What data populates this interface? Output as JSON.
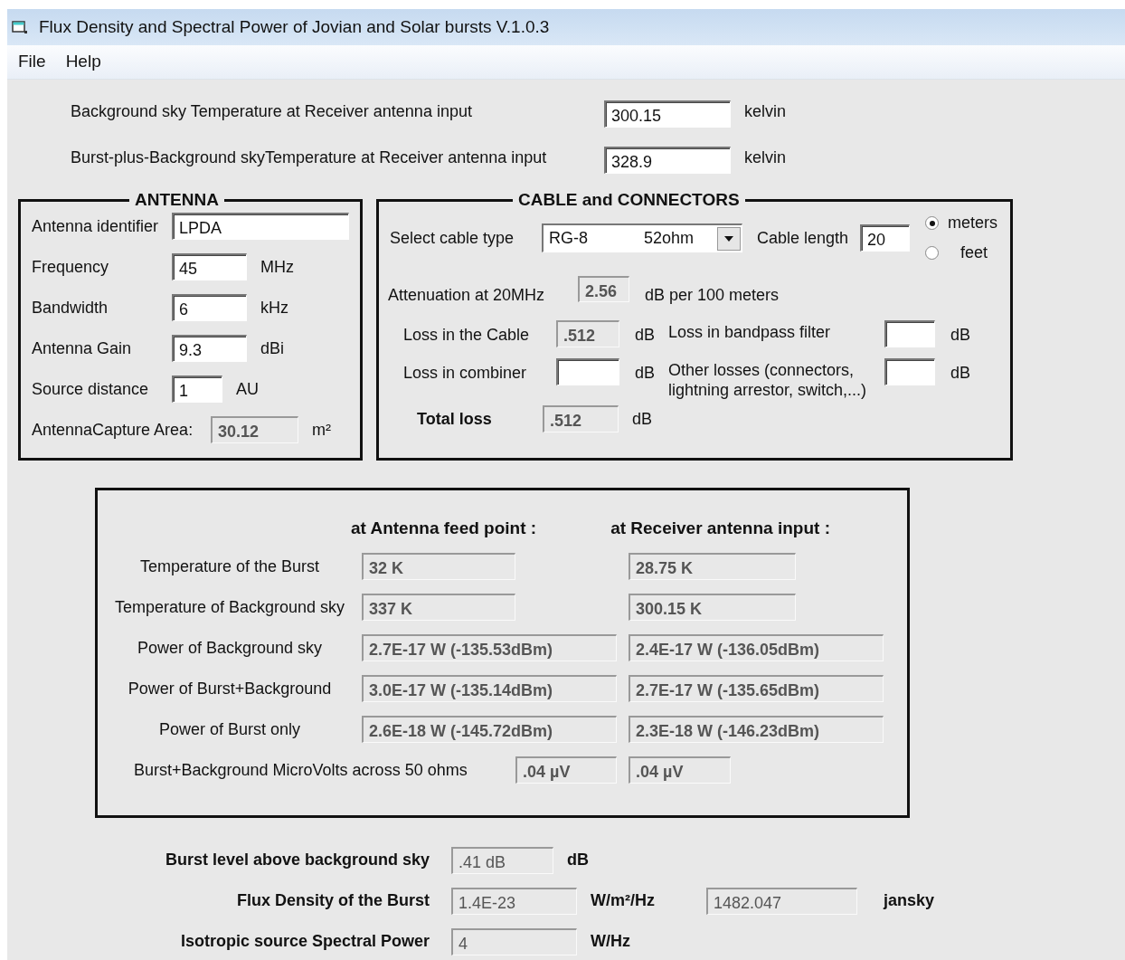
{
  "window": {
    "title": "Flux Density and Spectral Power of Jovian and Solar bursts  V.1.0.3"
  },
  "menu": [
    {
      "label": "File"
    },
    {
      "label": "Help"
    }
  ],
  "sky_fields": [
    {
      "label": "Background sky Temperature at Receiver antenna input",
      "value": "300.15",
      "unit": "kelvin",
      "disabled": false
    },
    {
      "label": "Burst-plus-Background skyTemperature at Receiver antenna input",
      "value": "328.9",
      "unit": "kelvin",
      "disabled": false
    }
  ],
  "antenna": {
    "title": "ANTENNA",
    "fields": [
      {
        "label": "Antenna identifier",
        "value": "LPDA",
        "disabled": false
      },
      {
        "label": "Frequency",
        "value": "45",
        "unit": "MHz",
        "disabled": false
      },
      {
        "label": "Bandwidth",
        "value": "6",
        "unit": "kHz",
        "disabled": false
      },
      {
        "label": "Antenna Gain",
        "value": "9.3",
        "unit": "dBi",
        "disabled": false
      },
      {
        "label": "Source distance",
        "value": "1",
        "unit": "AU",
        "disabled": false
      },
      {
        "label": "AntennaCapture Area:",
        "value": "30.12",
        "unit": "m²",
        "disabled": true
      }
    ]
  },
  "cable": {
    "title": "CABLE and CONNECTORS",
    "cable_type": {
      "label": "Select cable type",
      "value": "RG-8",
      "detail": "52ohm"
    },
    "cable_length": {
      "label": "Cable length",
      "value": "20",
      "disabled": false
    },
    "length_units": [
      {
        "label": "meters",
        "selected": true
      },
      {
        "label": "feet",
        "selected": false
      }
    ],
    "attenuation": {
      "label": "Attenuation at 20MHz",
      "value": "2.56",
      "unit": "dB per 100 meters",
      "disabled": true
    },
    "losses": [
      {
        "label": "Loss in the Cable",
        "value": ".512",
        "unit": "dB",
        "disabled": true
      },
      {
        "label": "Loss in bandpass filter",
        "unit": "dB",
        "disabled": false
      },
      {
        "label": "Loss in combiner",
        "unit": "dB",
        "disabled": false
      },
      {
        "label": "Other losses (connectors, lightning arrestor, switch,...)",
        "unit": "dB",
        "disabled": false
      }
    ],
    "total": {
      "label": "Total loss",
      "value": ".512",
      "unit": "dB",
      "disabled": true
    }
  },
  "results": {
    "columns": [
      "at Antenna feed point :",
      "at Receiver antenna input :"
    ],
    "rows": [
      {
        "label": "Temperature of the Burst",
        "values": [
          "32 K",
          "28.75 K"
        ]
      },
      {
        "label": "Temperature of Background sky",
        "values": [
          "337 K",
          "300.15 K"
        ]
      },
      {
        "label": "Power of Background sky",
        "values": [
          "2.7E-17 W  (-135.53dBm)",
          "2.4E-17 W  (-136.05dBm)"
        ]
      },
      {
        "label": "Power of Burst+Background",
        "values": [
          "3.0E-17 W  (-135.14dBm)",
          "2.7E-17 W  (-135.65dBm)"
        ]
      },
      {
        "label": "Power of Burst only",
        "values": [
          "2.6E-18 W  (-145.72dBm)",
          "2.3E-18 W  (-146.23dBm)"
        ]
      }
    ],
    "microvolts": {
      "label": "Burst+Background  MicroVolts across 50 ohms",
      "values": [
        ".04 µV",
        ".04 µV"
      ]
    }
  },
  "summary": [
    {
      "label": "Burst level above background sky",
      "value": ".41 dB",
      "unit": "dB"
    },
    {
      "label": "Flux Density of the Burst",
      "value": "1.4E-23",
      "unit": "W/m²/Hz",
      "extra_value": "1482.047",
      "extra_unit": "jansky"
    },
    {
      "label": "Isotropic source Spectral Power",
      "value": "4",
      "unit": "W/Hz"
    }
  ]
}
